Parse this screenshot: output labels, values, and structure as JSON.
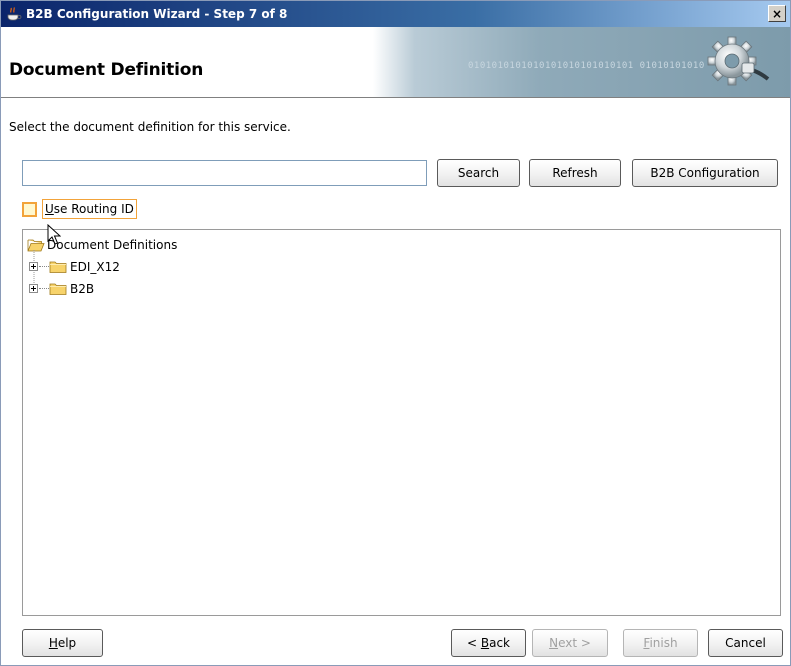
{
  "window": {
    "title": "B2B Configuration Wizard - Step 7 of 8",
    "close_glyph": "×"
  },
  "header": {
    "heading": "Document Definition",
    "banner_binary": "0101010101010101010101010101 01010101010",
    "banner_icon": "gear-plug-icon"
  },
  "main": {
    "instruction": "Select the document definition for this service.",
    "search": {
      "value": "",
      "placeholder": ""
    },
    "buttons": {
      "search": "Search",
      "refresh": "Refresh",
      "b2b_configuration": "B2B Configuration"
    },
    "routing": {
      "label_mnemonic": "U",
      "label_rest": "se Routing ID",
      "checked": false
    },
    "tree": {
      "root": {
        "label": "Document Definitions",
        "icon": "open-folder-icon"
      },
      "children": [
        {
          "label": "EDI_X12",
          "icon": "folder-icon",
          "expanded": false
        },
        {
          "label": "B2B",
          "icon": "folder-icon",
          "expanded": false
        }
      ]
    }
  },
  "footer": {
    "help": {
      "mnemonic": "H",
      "rest": "elp"
    },
    "back": {
      "prefix": "< ",
      "mnemonic": "B",
      "rest": "ack"
    },
    "next": {
      "mnemonic": "N",
      "rest": "ext >",
      "disabled": true
    },
    "finish": {
      "mnemonic": "F",
      "rest": "inish",
      "disabled": true
    },
    "cancel": {
      "label": "Cancel"
    }
  },
  "colors": {
    "title_start": "#0a246a",
    "title_end": "#a6caf0",
    "focus_orange": "#f2a33a",
    "folder_yellow": "#f7d36b"
  }
}
